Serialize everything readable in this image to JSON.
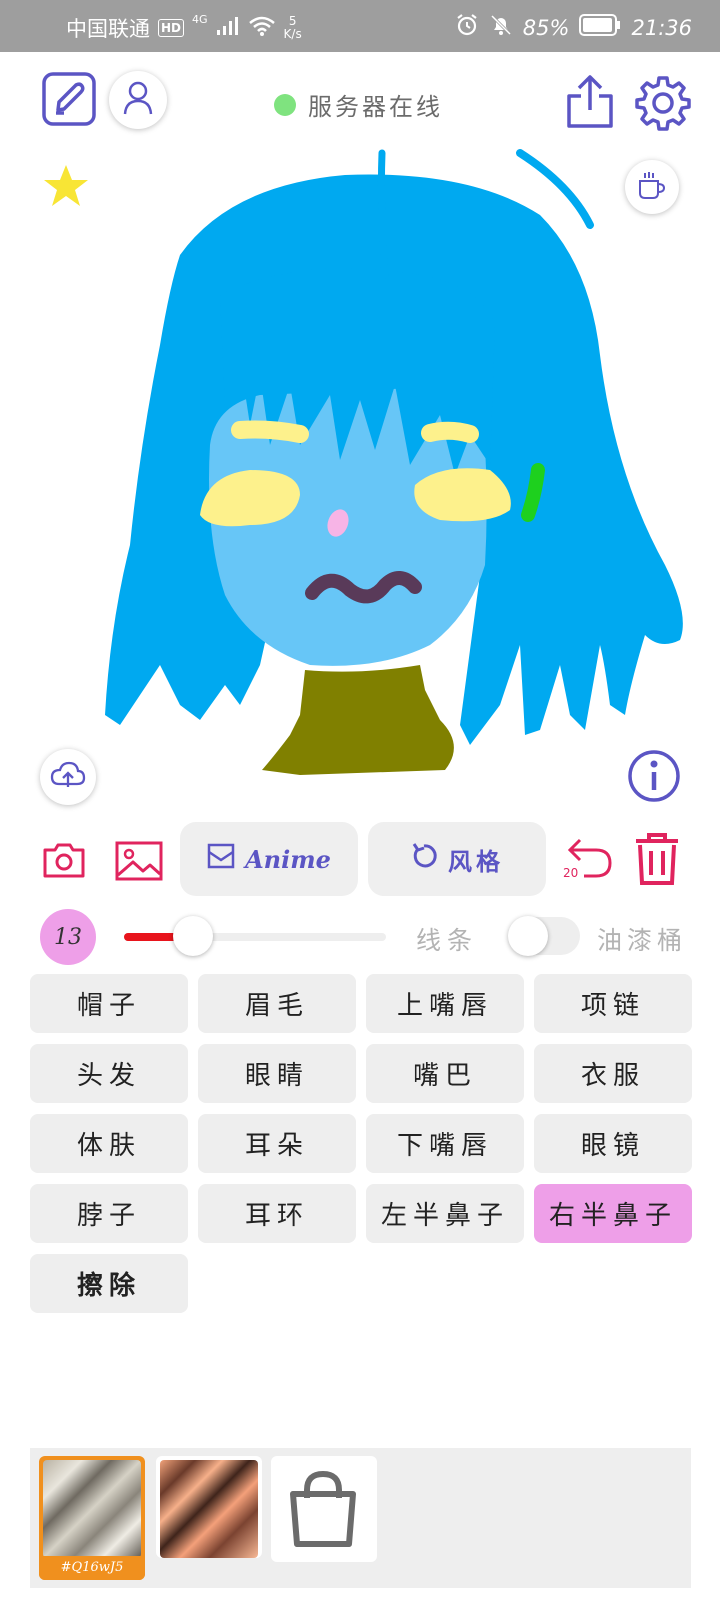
{
  "status_bar": {
    "carrier": "中国联通",
    "hd": "HD",
    "network": "4G",
    "speed_value": "5",
    "speed_unit": "K/s",
    "battery": "85%",
    "time": "21:36"
  },
  "header": {
    "server_status": "服务器在线",
    "server_status_color": "#7fe37f"
  },
  "canvas": {
    "background": "#ffffff",
    "hair_color": "#00a9f0",
    "skin_color": "#67c6f7",
    "eye_color": "#fdf18c",
    "mouth_color": "#593a59",
    "clothes_color": "#808000",
    "accent_color": "#1ed01e",
    "nose_color": "#f7b4e6"
  },
  "actions": {
    "style_model_label": "Anime",
    "style_button_label": "风格",
    "undo_count": "20",
    "accent_color": "#e0245e",
    "brand_color": "#5b55c4"
  },
  "brush": {
    "size": "13",
    "size_fraction": 0.22,
    "line_label": "线条",
    "bucket_label": "油漆桶",
    "bucket_enabled": false
  },
  "parts": [
    {
      "label": "帽子",
      "selected": false
    },
    {
      "label": "眉毛",
      "selected": false
    },
    {
      "label": "上嘴唇",
      "selected": false
    },
    {
      "label": "项链",
      "selected": false
    },
    {
      "label": "头发",
      "selected": false
    },
    {
      "label": "眼睛",
      "selected": false
    },
    {
      "label": "嘴巴",
      "selected": false
    },
    {
      "label": "衣服",
      "selected": false
    },
    {
      "label": "体肤",
      "selected": false
    },
    {
      "label": "耳朵",
      "selected": false
    },
    {
      "label": "下嘴唇",
      "selected": false
    },
    {
      "label": "眼镜",
      "selected": false
    },
    {
      "label": "脖子",
      "selected": false
    },
    {
      "label": "耳环",
      "selected": false
    },
    {
      "label": "左半鼻子",
      "selected": false
    },
    {
      "label": "右半鼻子",
      "selected": true
    },
    {
      "label": "擦除",
      "selected": false
    }
  ],
  "style_tray": {
    "items": [
      {
        "caption": "#Q16wJ5",
        "selected": true
      },
      {
        "caption": "",
        "selected": false
      }
    ]
  }
}
